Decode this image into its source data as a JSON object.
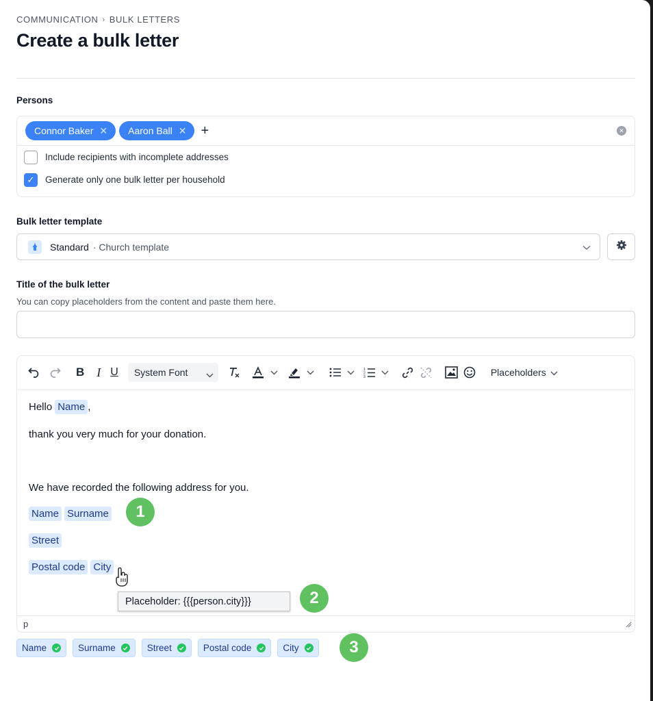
{
  "breadcrumb": {
    "items": [
      "COMMUNICATION",
      "BULK LETTERS"
    ],
    "separator": "›"
  },
  "page": {
    "title": "Create a bulk letter"
  },
  "persons": {
    "label": "Persons",
    "chips": [
      "Connor Baker",
      "Aaron Ball"
    ],
    "add_symbol": "+",
    "options": [
      {
        "label": "Include recipients with incomplete addresses",
        "checked": false
      },
      {
        "label": "Generate only one bulk letter per household",
        "checked": true
      }
    ]
  },
  "template": {
    "label": "Bulk letter template",
    "selected_name": "Standard",
    "selected_sub": "· Church template"
  },
  "title_field": {
    "label": "Title of the bulk letter",
    "hint": "You can copy placeholders from the content and paste them here.",
    "value": ""
  },
  "editor": {
    "font_label": "System Font",
    "placeholders_menu": "Placeholders",
    "toolbar_icons": [
      "undo-icon",
      "redo-icon",
      "bold-icon",
      "italic-icon",
      "underline-icon",
      "clear-format-icon",
      "text-color-icon",
      "highlight-icon",
      "bullet-list-icon",
      "numbered-list-icon",
      "link-icon",
      "unlink-icon",
      "image-icon",
      "emoji-icon"
    ],
    "greeting": "Hello",
    "greeting_ph": "Name",
    "greeting_comma": ",",
    "thanks": "thank you very much for your donation.",
    "address_intro": "We have recorded the following address for you.",
    "address_ph": {
      "name": "Name",
      "surname": "Surname",
      "street": "Street",
      "postal_code": "Postal code",
      "city": "City"
    },
    "status_path": "p"
  },
  "tooltip": {
    "text": "Placeholder: {{{person.city}}}"
  },
  "badges": [
    "1",
    "2",
    "3"
  ],
  "used_placeholders": [
    "Name",
    "Surname",
    "Street",
    "Postal code",
    "City"
  ],
  "colors": {
    "accent": "#3b82f6",
    "placeholder_bg": "#dbeafe",
    "badge": "#5fc15f",
    "check": "#22c55e"
  }
}
